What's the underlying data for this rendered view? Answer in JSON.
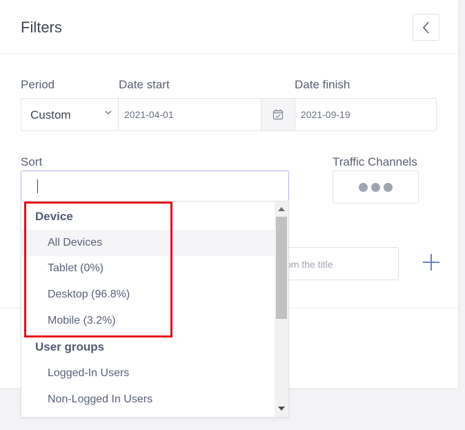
{
  "header": {
    "title": "Filters",
    "back_icon": "chevron-left-icon"
  },
  "labels": {
    "period": "Period",
    "date_start": "Date start",
    "date_finish": "Date finish",
    "sort": "Sort",
    "traffic_channels": "Traffic Channels"
  },
  "period_select": {
    "value": "Custom"
  },
  "date_start": {
    "value": "2021-04-01"
  },
  "calendar_icon": "calendar-icon",
  "date_finish": {
    "value": "2021-09-19"
  },
  "sort_input": {
    "value": ""
  },
  "traffic_button": {
    "icon": "more-horizontal-icon"
  },
  "title_input": {
    "placeholder_visible": "om the title"
  },
  "add_icon": "plus-icon",
  "dropdown": {
    "groups": [
      {
        "label": "Device",
        "options": [
          {
            "label": "All Devices",
            "highlighted": true
          },
          {
            "label": "Tablet (0%)"
          },
          {
            "label": "Desktop (96.8%)"
          },
          {
            "label": "Mobile (3.2%)"
          }
        ]
      },
      {
        "label": "User groups",
        "options": [
          {
            "label": "Logged-In Users"
          },
          {
            "label": "Non-Logged In Users"
          }
        ]
      }
    ]
  },
  "colors": {
    "highlight_outline": "#e31017",
    "accent": "#5c6bd6",
    "focus_border": "#aeb4e6"
  }
}
